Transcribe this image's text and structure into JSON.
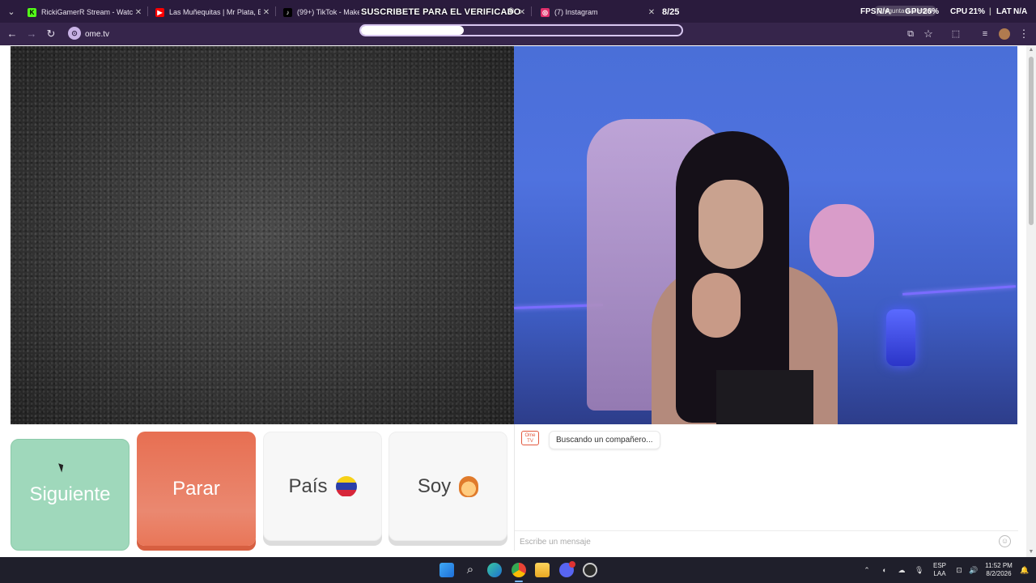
{
  "browser": {
    "tabs": [
      {
        "title": "RickiGamerR Stream - Watch Li",
        "favicon": "kick-icon",
        "color": "#53fc18"
      },
      {
        "title": "Las Muñequitas | Mr Plata, El A",
        "favicon": "youtube-icon",
        "color": "#ff0000"
      },
      {
        "title": "(99+) TikTok - Make Yo",
        "favicon": "tiktok-icon",
        "color": "#ffffff"
      },
      {
        "title": "(7) Instagram",
        "favicon": "instagram-icon",
        "color": "#e1306c"
      }
    ],
    "url": "ome.tv"
  },
  "overlay": {
    "title": "SUSCRIBETE PARA EL VERIFICADO",
    "count": "8/25",
    "progress": 0.32
  },
  "hud": {
    "fps_label": "FPS",
    "fps_value": "N/A",
    "gpu_label": "GPU",
    "gpu_value": "26%",
    "cpu_label": "CPU",
    "cpu_value": "21%",
    "lat_label": "LAT",
    "lat_value": "N/A",
    "gemini": "Pregunta a Gemini"
  },
  "omegle": {
    "next_label": "Siguiente",
    "stop_label": "Parar",
    "country_label": "País",
    "soy_label": "Soy",
    "chat_status": "Buscando un compañero...",
    "chat_logo": "Ome TV",
    "input_placeholder": "Escribe un mensaje"
  },
  "taskbar": {
    "lang_top": "ESP",
    "lang_bottom": "LAA",
    "time": "11:52 PM",
    "date": "8/2/2026",
    "discord_badge": "9+"
  },
  "colors": {
    "next": "#9fd8bb",
    "stop": "#e76f52",
    "tabbar": "#2a1b3d"
  }
}
